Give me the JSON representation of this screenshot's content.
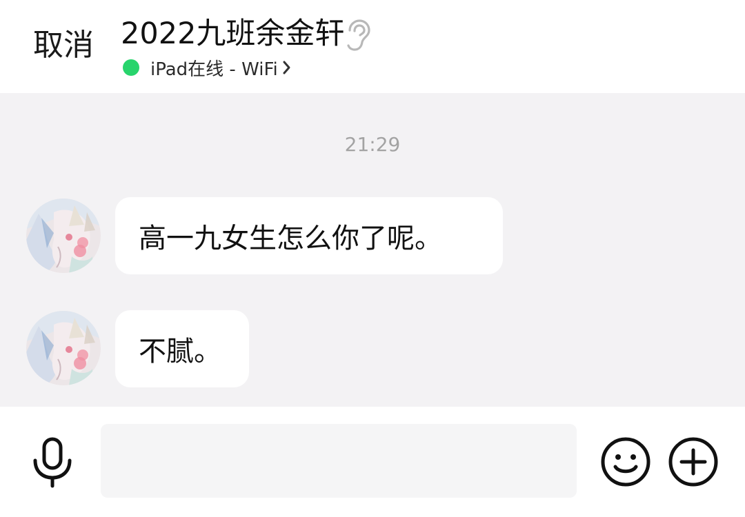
{
  "header": {
    "cancel_label": "取消",
    "title": "2022九班余金轩",
    "status_text": "iPad在线 - WiFi",
    "status_color": "#28d46c"
  },
  "chat": {
    "timestamp": "21:29",
    "messages": [
      {
        "sender": "contact",
        "text": "高一九女生怎么你了呢。"
      },
      {
        "sender": "contact",
        "text": "不腻。"
      }
    ]
  },
  "input_bar": {
    "value": "",
    "placeholder": ""
  },
  "icons": {
    "ear": "ear-icon",
    "chevron": "chevron-right-icon",
    "mic": "microphone-icon",
    "emoji": "smiley-face-icon",
    "plus": "plus-circle-icon"
  },
  "colors": {
    "chat_background": "#f3f2f4",
    "bubble_background": "#ffffff",
    "timestamp": "#a3a3a3"
  }
}
